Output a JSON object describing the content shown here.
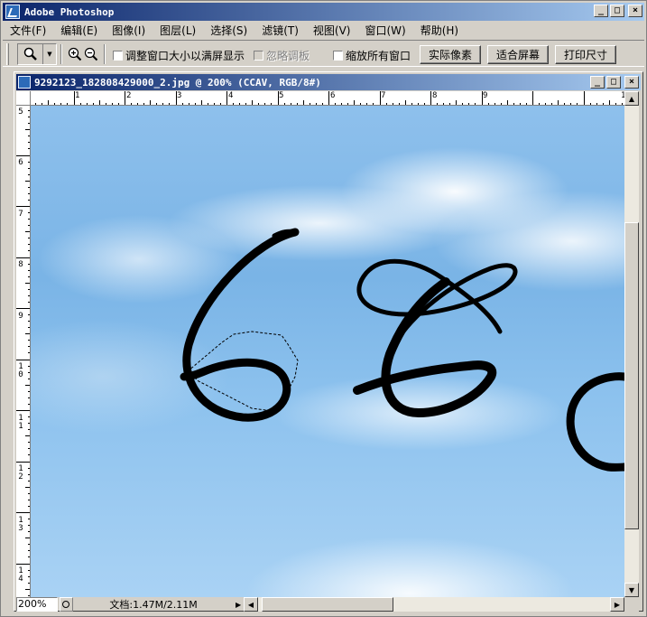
{
  "app": {
    "title": "Adobe Photoshop",
    "window_buttons": {
      "minimize": "_",
      "maximize": "□",
      "close": "×"
    }
  },
  "menu": {
    "items": [
      "文件(F)",
      "编辑(E)",
      "图像(I)",
      "图层(L)",
      "选择(S)",
      "滤镜(T)",
      "视图(V)",
      "窗口(W)",
      "帮助(H)"
    ]
  },
  "options": {
    "tool_icon": "magnifier-icon",
    "zoom_in_icon": "zoom-in-icon",
    "zoom_out_icon": "zoom-out-icon",
    "resize_windows_label": "调整窗口大小以满屏显示",
    "ignore_palettes_label": "忽略调板",
    "zoom_all_windows_label": "缩放所有窗口",
    "actual_pixels_label": "实际像素",
    "fit_screen_label": "适合屏幕",
    "print_size_label": "打印尺寸"
  },
  "document": {
    "title": "9292123_182808429000_2.jpg @ 200% (CCAV, RGB/8#)",
    "ruler_h": [
      "1",
      "2",
      "3",
      "4",
      "5",
      "6",
      "7",
      "8",
      "9",
      "1"
    ],
    "ruler_v": [
      "5",
      "6",
      "7",
      "8",
      "9",
      "10",
      "11",
      "12",
      "13",
      "14"
    ],
    "zoom": "200%",
    "doc_info": "文档:1.47M/2.11M",
    "colors": {
      "sky": "#7ab4e6",
      "ink": "#000000",
      "title_start": "#0a246a",
      "title_end": "#a6caf0"
    }
  }
}
